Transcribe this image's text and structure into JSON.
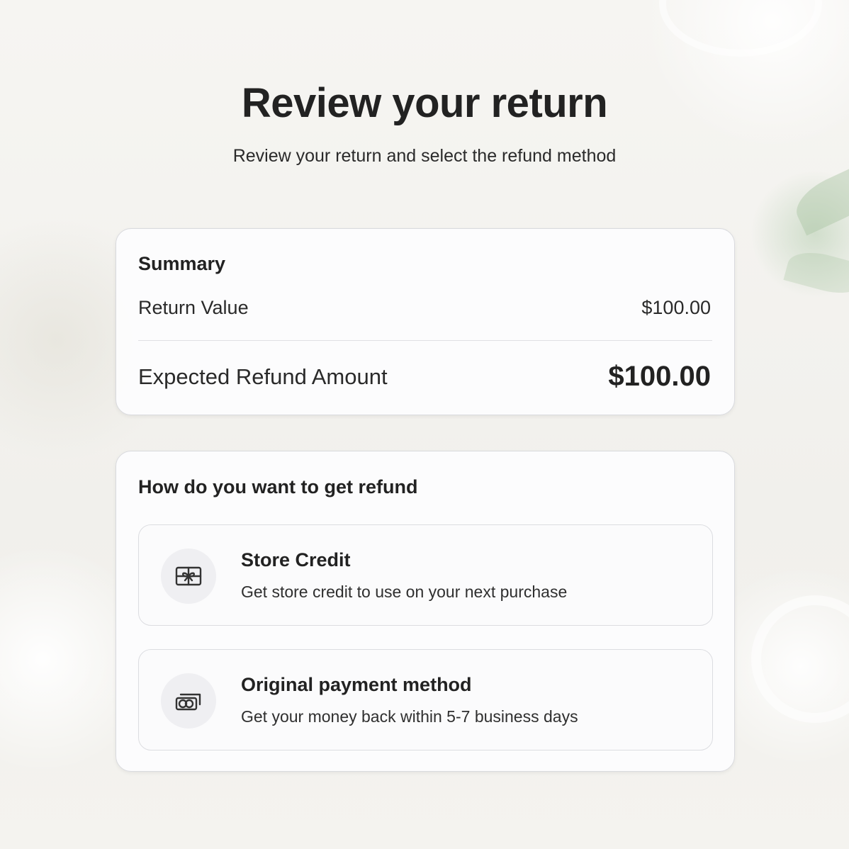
{
  "header": {
    "title": "Review your return",
    "subtitle": "Review your return and select the refund method"
  },
  "summary": {
    "heading": "Summary",
    "return_value_label": "Return Value",
    "return_value": "$100.00",
    "expected_refund_label": "Expected Refund Amount",
    "expected_refund_value": "$100.00"
  },
  "refund": {
    "heading": "How do you want to get refund",
    "options": [
      {
        "title": "Store Credit",
        "description": "Get store credit to use on your next purchase",
        "icon": "gift-card-icon"
      },
      {
        "title": "Original payment method",
        "description": "Get your money back within 5-7 business days",
        "icon": "cash-icon"
      }
    ]
  },
  "colors": {
    "text": "#222222",
    "card_background": "#fcfcfd",
    "border": "#d9dade",
    "icon_circle": "#efeff2"
  }
}
